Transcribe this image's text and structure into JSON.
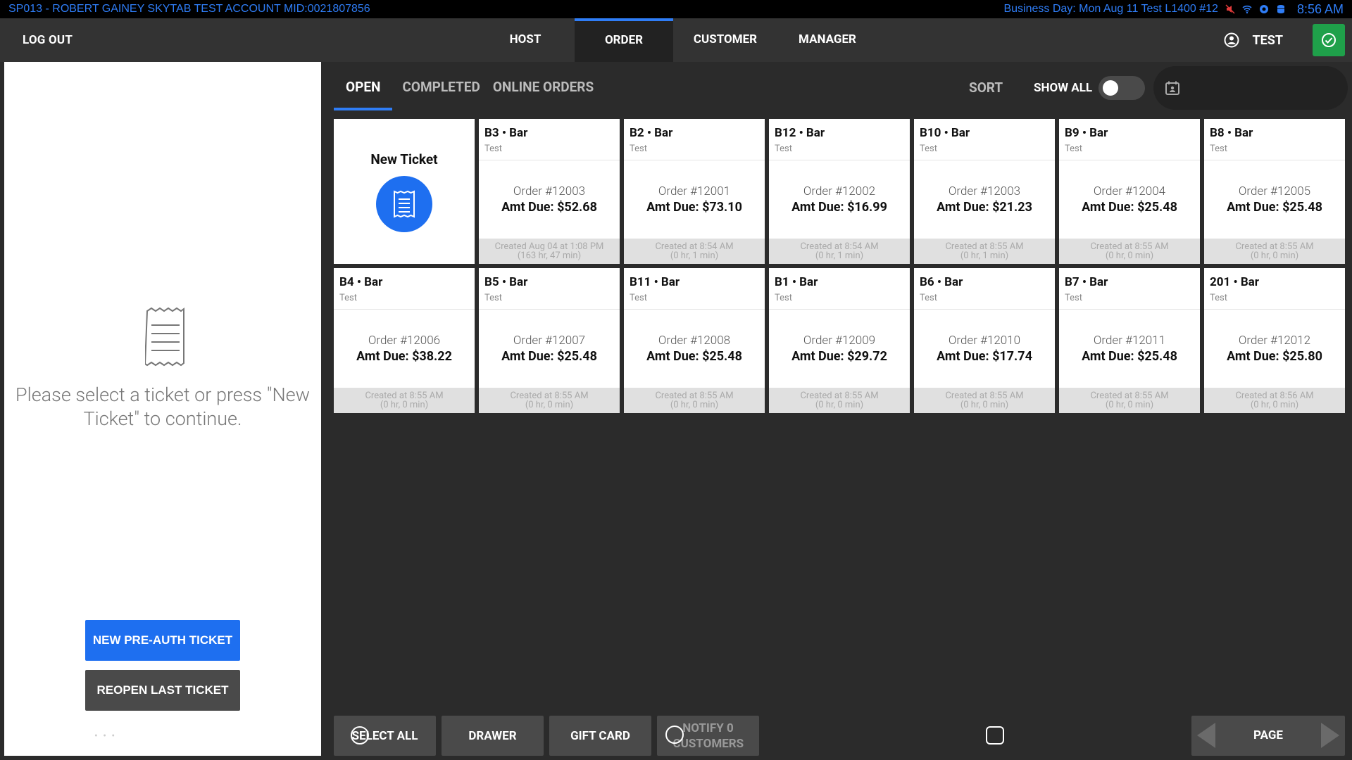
{
  "statusbar": {
    "account": "SP013 - ROBERT GAINEY SKYTAB TEST ACCOUNT   MID:0021807856",
    "business_day": "Business Day: Mon Aug 11  Test L1400  #12",
    "time": "8:56 AM",
    "icons": [
      "mute-icon",
      "wifi-icon",
      "circle-icon",
      "database-icon"
    ],
    "color": "#2f7df6"
  },
  "nav": {
    "logout": "LOG OUT",
    "tabs": [
      "HOST",
      "ORDER",
      "CUSTOMER",
      "MANAGER"
    ],
    "active_tab": "ORDER",
    "user": "TEST",
    "confirm_color": "#1fa04a"
  },
  "left": {
    "message": "Please select a ticket or press \"New Ticket\" to continue.",
    "preauth_button": "NEW PRE-AUTH TICKET",
    "reopen_button": "REOPEN LAST TICKET",
    "dots": "• • •"
  },
  "tickets_view": {
    "subtabs": [
      "OPEN",
      "COMPLETED",
      "ONLINE ORDERS"
    ],
    "active_subtab": "OPEN",
    "sort": "SORT",
    "show_all": "SHOW ALL",
    "show_all_on": false,
    "new_ticket": "New Ticket",
    "tickets": [
      {
        "table": "B3 • Bar",
        "server": "Test",
        "order": "Order #12003",
        "amount": "Amt Due: $52.68",
        "created": "Created Aug 04 at 1:08 PM",
        "elapsed": "(163 hr, 47 min)"
      },
      {
        "table": "B2 • Bar",
        "server": "Test",
        "order": "Order #12001",
        "amount": "Amt Due: $73.10",
        "created": "Created at 8:54 AM",
        "elapsed": "(0 hr, 1 min)"
      },
      {
        "table": "B12 • Bar",
        "server": "Test",
        "order": "Order #12002",
        "amount": "Amt Due: $16.99",
        "created": "Created at 8:54 AM",
        "elapsed": "(0 hr, 1 min)"
      },
      {
        "table": "B10 • Bar",
        "server": "Test",
        "order": "Order #12003",
        "amount": "Amt Due: $21.23",
        "created": "Created at 8:55 AM",
        "elapsed": "(0 hr, 1 min)"
      },
      {
        "table": "B9 • Bar",
        "server": "Test",
        "order": "Order #12004",
        "amount": "Amt Due: $25.48",
        "created": "Created at 8:55 AM",
        "elapsed": "(0 hr, 0 min)"
      },
      {
        "table": "B8 • Bar",
        "server": "Test",
        "order": "Order #12005",
        "amount": "Amt Due: $25.48",
        "created": "Created at 8:55 AM",
        "elapsed": "(0 hr, 0 min)"
      },
      {
        "table": "B4 • Bar",
        "server": "Test",
        "order": "Order #12006",
        "amount": "Amt Due: $38.22",
        "created": "Created at 8:55 AM",
        "elapsed": "(0 hr, 0 min)"
      },
      {
        "table": "B5 • Bar",
        "server": "Test",
        "order": "Order #12007",
        "amount": "Amt Due: $25.48",
        "created": "Created at 8:55 AM",
        "elapsed": "(0 hr, 0 min)"
      },
      {
        "table": "B11 • Bar",
        "server": "Test",
        "order": "Order #12008",
        "amount": "Amt Due: $25.48",
        "created": "Created at 8:55 AM",
        "elapsed": "(0 hr, 0 min)"
      },
      {
        "table": "B1 • Bar",
        "server": "Test",
        "order": "Order #12009",
        "amount": "Amt Due: $29.72",
        "created": "Created at 8:55 AM",
        "elapsed": "(0 hr, 0 min)"
      },
      {
        "table": "B6 • Bar",
        "server": "Test",
        "order": "Order #12010",
        "amount": "Amt Due: $17.74",
        "created": "Created at 8:55 AM",
        "elapsed": "(0 hr, 0 min)"
      },
      {
        "table": "B7 • Bar",
        "server": "Test",
        "order": "Order #12011",
        "amount": "Amt Due: $25.48",
        "created": "Created at 8:55 AM",
        "elapsed": "(0 hr, 0 min)"
      },
      {
        "table": "201 • Bar",
        "server": "Test",
        "order": "Order #12012",
        "amount": "Amt Due: $25.80",
        "created": "Created at 8:56 AM",
        "elapsed": "(0 hr, 0 min)"
      }
    ]
  },
  "bottom": {
    "select_all": "SELECT ALL",
    "drawer": "DRAWER",
    "gift_card": "GIFT CARD",
    "notify": "NOTIFY 0 CUSTOMERS",
    "page": "PAGE"
  }
}
